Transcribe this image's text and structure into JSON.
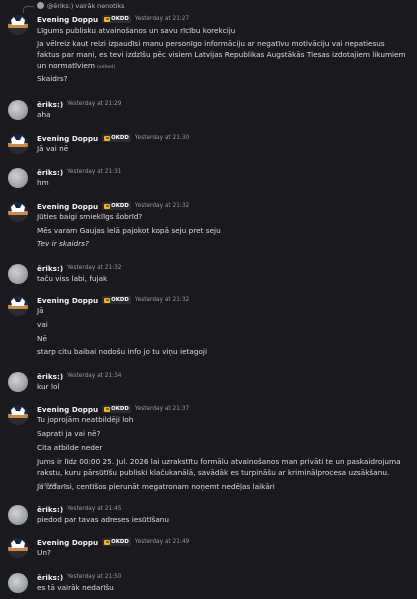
{
  "reply": {
    "text": "@ēriks:) vairāk nenotiks"
  },
  "users": {
    "doppu": {
      "name": "Evening Doppu",
      "badge": "OKDD"
    },
    "eriks": {
      "name": "ēriks:)"
    }
  },
  "edited_label": "(edited)",
  "messages": [
    {
      "time": "Yesterday at 21:27",
      "lines": [
        "Līgums publisku atvainošanos un savu rīcību korekciju",
        "Ja vēlreiz kaut reizi izpaudīsi manu personīgo informāciju ar negatīvu motivāciju vai nepatiesus faktus par mani, es tevi izdzīšu pēc visiem Latvijas Republikas Augstākās Tiesas izdotajiem likumiem un normatīviem",
        "Skaidrs?"
      ]
    },
    {
      "time": "Yesterday at 21:29",
      "lines": [
        "aha"
      ]
    },
    {
      "time": "Yesterday at 21:30",
      "lines": [
        "Jā vai nē"
      ]
    },
    {
      "time": "Yesterday at 21:31",
      "lines": [
        "hm"
      ]
    },
    {
      "time": "Yesterday at 21:32",
      "lines": [
        "Jūties baigi smieklīgs šobrīd?",
        "Mēs varam Gaujas lelā pajokot kopā seju pret seju",
        "Tev ir skaidrs?"
      ]
    },
    {
      "time": "Yesterday at 21:32",
      "lines": [
        "taču viss labi, fujak"
      ]
    },
    {
      "time": "Yesterday at 21:32",
      "lines": [
        "Jā",
        "vai",
        "Nē",
        "starp citu baibai nodošu info jo tu viņu ietagoji"
      ]
    },
    {
      "time": "Yesterday at 21:34",
      "lines": [
        "kur lol"
      ]
    },
    {
      "time": "Yesterday at 21:37",
      "lines": [
        "Tu joprojām neatbildēji loh",
        "Saprati ja vai nē?",
        "Cita atbilde neder",
        "Jums ir līdz 00:00 25. Jul. 2026 lai uzrakstītu formālu atvainošanos man privāti te un paskaidrojuma rakstu, kuru pārsūtīšu publiski klačukanālā, savādāk es turpināšu ar kriminālprocesa uzsākšanu.",
        "Ja izdarīsi, centīšos pierunāt megatronam noņemt nedēļas laikāri"
      ]
    },
    {
      "time": "Yesterday at 21:45",
      "lines": [
        "piedod par tavas adreses iesūtīšanu"
      ]
    },
    {
      "time": "Yesterday at 21:49",
      "lines": [
        "Un?"
      ]
    },
    {
      "time": "Yesterday at 21:50",
      "lines": [
        "es tā vairāk nedarīšu"
      ]
    }
  ]
}
